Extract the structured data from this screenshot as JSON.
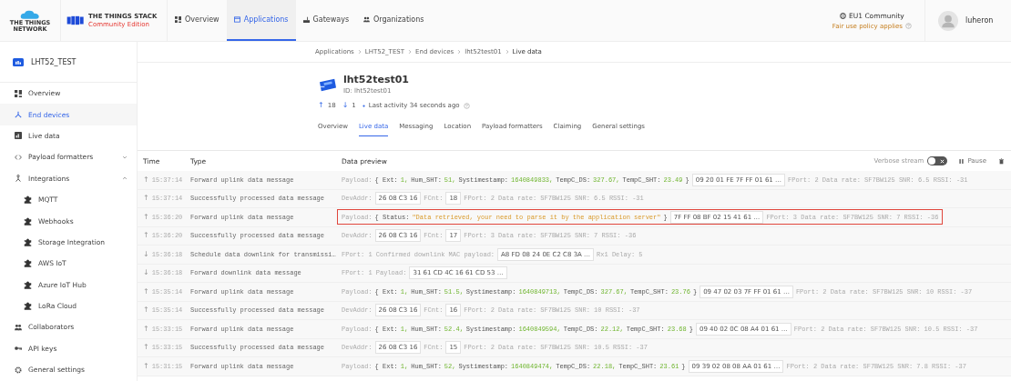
{
  "top_bar": {
    "brand_network": "THE THINGS NETWORK",
    "brand_title": "THE THINGS STACK",
    "brand_edition": "Community Edition",
    "nav": [
      {
        "label": "Overview",
        "selected": false
      },
      {
        "label": "Applications",
        "selected": true
      },
      {
        "label": "Gateways",
        "selected": false
      },
      {
        "label": "Organizations",
        "selected": false
      }
    ],
    "cluster": "EU1 Community",
    "fair_use": "Fair use policy applies",
    "user": "luheron"
  },
  "sidebar": {
    "app_name": "LHT52_TEST",
    "items": [
      {
        "label": "Overview",
        "selected": false
      },
      {
        "label": "End devices",
        "selected": true
      },
      {
        "label": "Live data",
        "selected": false
      },
      {
        "label": "Payload formatters",
        "selected": false,
        "expanded": false
      },
      {
        "label": "Integrations",
        "selected": false,
        "expanded": true,
        "children": [
          {
            "label": "MQTT",
            "selected": false
          },
          {
            "label": "Webhooks",
            "selected": false
          },
          {
            "label": "Storage Integration",
            "selected": false
          },
          {
            "label": "AWS IoT",
            "selected": false
          },
          {
            "label": "Azure IoT Hub",
            "selected": false
          },
          {
            "label": "LoRa Cloud",
            "selected": false
          }
        ]
      },
      {
        "label": "Collaborators",
        "selected": false
      },
      {
        "label": "API keys",
        "selected": false
      },
      {
        "label": "General settings",
        "selected": false
      }
    ]
  },
  "breadcrumbs": [
    "Applications",
    "LHT52_TEST",
    "End devices",
    "lht52test01",
    "Live data"
  ],
  "device": {
    "name": "lht52test01",
    "id": "ID: lht52test01",
    "uplink_arrow": "↑",
    "uplinks": "18",
    "downlink_arrow": "↓",
    "downlinks": "1",
    "last_activity": "Last activity 34 seconds ago"
  },
  "device_tabs": [
    {
      "label": "Overview",
      "selected": false
    },
    {
      "label": "Live data",
      "selected": true
    },
    {
      "label": "Messaging",
      "selected": false
    },
    {
      "label": "Location",
      "selected": false
    },
    {
      "label": "Payload formatters",
      "selected": false
    },
    {
      "label": "Claiming",
      "selected": false
    },
    {
      "label": "General settings",
      "selected": false
    }
  ],
  "table": {
    "columns": [
      "Time",
      "Type",
      "Data preview"
    ],
    "verbose_label": "Verbose stream",
    "verbose_on": false,
    "pause_label": "Pause",
    "rows": [
      {
        "arrow": "↑",
        "time": "15:37:14",
        "type": "Forward uplink data message",
        "highlighted": false,
        "preview": [
          {
            "kind": "label",
            "text": "Payload:"
          },
          {
            "kind": "key",
            "text": "{ Ext:"
          },
          {
            "kind": "num",
            "text": "1,"
          },
          {
            "kind": "key",
            "text": "Hum_SHT:"
          },
          {
            "kind": "num",
            "text": "51,"
          },
          {
            "kind": "key",
            "text": "Systimestamp:"
          },
          {
            "kind": "num",
            "text": "1640849833,"
          },
          {
            "kind": "key",
            "text": "TempC_DS:"
          },
          {
            "kind": "num",
            "text": "327.67,"
          },
          {
            "kind": "key",
            "text": "TempC_SHT:"
          },
          {
            "kind": "num",
            "text": "23.49"
          },
          {
            "kind": "key",
            "text": "}"
          },
          {
            "kind": "box",
            "text": "09 20 01 FE 7F FF 01 61 …"
          },
          {
            "kind": "label",
            "text": "FPort: 2 Data rate: SF7BW125 SNR: 6.5 RSSI: -31"
          }
        ]
      },
      {
        "arrow": "↑",
        "time": "15:37:14",
        "type": "Successfully processed data message",
        "highlighted": false,
        "preview": [
          {
            "kind": "label",
            "text": "DevAddr:"
          },
          {
            "kind": "box",
            "text": "26 08 C3 16"
          },
          {
            "kind": "label",
            "text": "FCnt:"
          },
          {
            "kind": "box",
            "text": "18"
          },
          {
            "kind": "label",
            "text": "FPort: 2 Data rate: SF7BW125 SNR: 6.5 RSSI: -31"
          }
        ]
      },
      {
        "arrow": "↑",
        "time": "15:36:20",
        "type": "Forward uplink data message",
        "highlighted": true,
        "preview": [
          {
            "kind": "label",
            "text": "Payload:"
          },
          {
            "kind": "key",
            "text": "{ Status:"
          },
          {
            "kind": "str",
            "text": "\"Data retrieved, your need to parse it by the application server\""
          },
          {
            "kind": "key",
            "text": "}"
          },
          {
            "kind": "box",
            "text": "7F FF 08 BF 02 15 41 61 …"
          },
          {
            "kind": "label",
            "text": "FPort: 3 Data rate: SF7BW125 SNR: 7 RSSI: -36"
          }
        ]
      },
      {
        "arrow": "↑",
        "time": "15:36:20",
        "type": "Successfully processed data message",
        "highlighted": false,
        "preview": [
          {
            "kind": "label",
            "text": "DevAddr:"
          },
          {
            "kind": "box",
            "text": "26 08 C3 16"
          },
          {
            "kind": "label",
            "text": "FCnt:"
          },
          {
            "kind": "box",
            "text": "17"
          },
          {
            "kind": "label",
            "text": "FPort: 3 Data rate: SF7BW125 SNR: 7 RSSI: -36"
          }
        ]
      },
      {
        "arrow": "↓",
        "time": "15:36:18",
        "type": "Schedule data downlink for transmissi…",
        "highlighted": false,
        "preview": [
          {
            "kind": "label",
            "text": "FPort: 1 Confirmed downlink MAC payload:"
          },
          {
            "kind": "box",
            "text": "A8 FD 08 24 0E C2 C8 3A …"
          },
          {
            "kind": "label",
            "text": "Rx1 Delay: 5"
          }
        ]
      },
      {
        "arrow": "↓",
        "time": "15:36:18",
        "type": "Forward downlink data message",
        "highlighted": false,
        "preview": [
          {
            "kind": "label",
            "text": "FPort: 1 Payload:"
          },
          {
            "kind": "box",
            "text": "31 61 CD 4C 16 61 CD 53 …"
          }
        ]
      },
      {
        "arrow": "↑",
        "time": "15:35:14",
        "type": "Forward uplink data message",
        "highlighted": false,
        "preview": [
          {
            "kind": "label",
            "text": "Payload:"
          },
          {
            "kind": "key",
            "text": "{ Ext:"
          },
          {
            "kind": "num",
            "text": "1,"
          },
          {
            "kind": "key",
            "text": "Hum_SHT:"
          },
          {
            "kind": "num",
            "text": "51.5,"
          },
          {
            "kind": "key",
            "text": "Systimestamp:"
          },
          {
            "kind": "num",
            "text": "1640849713,"
          },
          {
            "kind": "key",
            "text": "TempC_DS:"
          },
          {
            "kind": "num",
            "text": "327.67,"
          },
          {
            "kind": "key",
            "text": "TempC_SHT:"
          },
          {
            "kind": "num",
            "text": "23.76"
          },
          {
            "kind": "key",
            "text": "}"
          },
          {
            "kind": "box",
            "text": "09 47 02 03 7F FF 01 61 …"
          },
          {
            "kind": "label",
            "text": "FPort: 2 Data rate: SF7BW125 SNR: 10 RSSI: -37"
          }
        ]
      },
      {
        "arrow": "↑",
        "time": "15:35:14",
        "type": "Successfully processed data message",
        "highlighted": false,
        "preview": [
          {
            "kind": "label",
            "text": "DevAddr:"
          },
          {
            "kind": "box",
            "text": "26 08 C3 16"
          },
          {
            "kind": "label",
            "text": "FCnt:"
          },
          {
            "kind": "box",
            "text": "16"
          },
          {
            "kind": "label",
            "text": "FPort: 2 Data rate: SF7BW125 SNR: 10 RSSI: -37"
          }
        ]
      },
      {
        "arrow": "↑",
        "time": "15:33:15",
        "type": "Forward uplink data message",
        "highlighted": false,
        "preview": [
          {
            "kind": "label",
            "text": "Payload:"
          },
          {
            "kind": "key",
            "text": "{ Ext:"
          },
          {
            "kind": "num",
            "text": "1,"
          },
          {
            "kind": "key",
            "text": "Hum_SHT:"
          },
          {
            "kind": "num",
            "text": "52.4,"
          },
          {
            "kind": "key",
            "text": "Systimestamp:"
          },
          {
            "kind": "num",
            "text": "1640849594,"
          },
          {
            "kind": "key",
            "text": "TempC_DS:"
          },
          {
            "kind": "num",
            "text": "22.12,"
          },
          {
            "kind": "key",
            "text": "TempC_SHT:"
          },
          {
            "kind": "num",
            "text": "23.68"
          },
          {
            "kind": "key",
            "text": "}"
          },
          {
            "kind": "box",
            "text": "09 40 02 0C 08 A4 01 61 …"
          },
          {
            "kind": "label",
            "text": "FPort: 2 Data rate: SF7BW125 SNR: 10.5 RSSI: -37"
          }
        ]
      },
      {
        "arrow": "↑",
        "time": "15:33:15",
        "type": "Successfully processed data message",
        "highlighted": false,
        "preview": [
          {
            "kind": "label",
            "text": "DevAddr:"
          },
          {
            "kind": "box",
            "text": "26 08 C3 16"
          },
          {
            "kind": "label",
            "text": "FCnt:"
          },
          {
            "kind": "box",
            "text": "15"
          },
          {
            "kind": "label",
            "text": "FPort: 2 Data rate: SF7BW125 SNR: 10.5 RSSI: -37"
          }
        ]
      },
      {
        "arrow": "↑",
        "time": "15:31:15",
        "type": "Forward uplink data message",
        "highlighted": false,
        "preview": [
          {
            "kind": "label",
            "text": "Payload:"
          },
          {
            "kind": "key",
            "text": "{ Ext:"
          },
          {
            "kind": "num",
            "text": "1,"
          },
          {
            "kind": "key",
            "text": "Hum_SHT:"
          },
          {
            "kind": "num",
            "text": "52,"
          },
          {
            "kind": "key",
            "text": "Systimestamp:"
          },
          {
            "kind": "num",
            "text": "1640849474,"
          },
          {
            "kind": "key",
            "text": "TempC_DS:"
          },
          {
            "kind": "num",
            "text": "22.18,"
          },
          {
            "kind": "key",
            "text": "TempC_SHT:"
          },
          {
            "kind": "num",
            "text": "23.61"
          },
          {
            "kind": "key",
            "text": "}"
          },
          {
            "kind": "box",
            "text": "09 39 02 08 08 AA 01 61 …"
          },
          {
            "kind": "label",
            "text": "FPort: 2 Data rate: SF7BW125 SNR: 7.8 RSSI: -37"
          }
        ]
      }
    ]
  }
}
